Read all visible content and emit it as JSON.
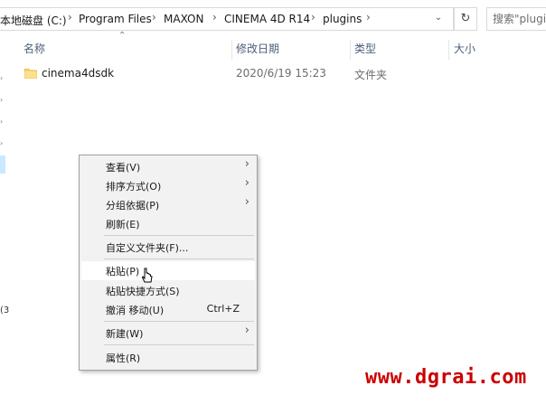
{
  "address": {
    "crumbs": [
      "本地磁盘 (C:)",
      "Program Files",
      "MAXON",
      "CINEMA 4D R14",
      "plugins"
    ],
    "separator": "›",
    "dropdown_icon": "chevron-down-icon",
    "refresh_icon": "refresh-icon"
  },
  "search": {
    "placeholder": "搜索\"plugins\""
  },
  "columns": {
    "name": "名称",
    "date": "修改日期",
    "type": "类型",
    "size": "大小",
    "sort_icon": "chevron-up-icon"
  },
  "files": [
    {
      "name": "cinema4dsdk",
      "date": "2020/6/19 15:23",
      "type": "文件夹",
      "icon": "folder-icon"
    }
  ],
  "nav_fragment": "(3",
  "context_menu": {
    "items": [
      {
        "label": "查看(V)",
        "submenu": true
      },
      {
        "label": "排序方式(O)",
        "submenu": true
      },
      {
        "label": "分组依据(P)",
        "submenu": true
      },
      {
        "label": "刷新(E)"
      },
      {
        "label": "自定义文件夹(F)..."
      },
      {
        "label": "粘贴(P)",
        "highlighted": true
      },
      {
        "label": "粘贴快捷方式(S)"
      },
      {
        "label": "撤消 移动(U)",
        "shortcut": "Ctrl+Z"
      },
      {
        "label": "新建(W)",
        "submenu": true
      },
      {
        "label": "属性(R)"
      }
    ],
    "submenu_glyph": "›"
  },
  "watermark": "www.dgrai.com",
  "colors": {
    "header_text": "#4c607a",
    "menu_bg": "#f2f2f2",
    "watermark": "#cc0000"
  }
}
